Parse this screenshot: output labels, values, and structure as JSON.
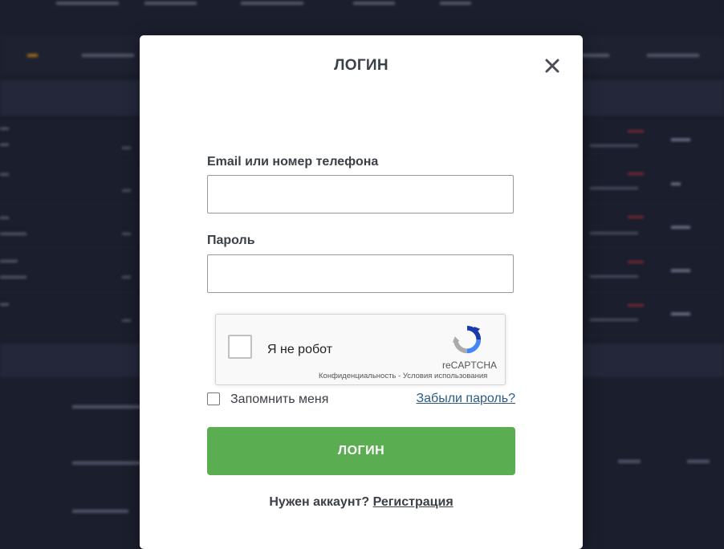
{
  "modal": {
    "title": "ЛОГИН",
    "email_label": "Email или номер телефона",
    "email_value": "",
    "password_label": "Пароль",
    "password_value": "",
    "captcha": {
      "label": "Я не робот",
      "brand": "reCAPTCHA",
      "privacy": "Конфиденциальность",
      "separator": " - ",
      "terms": "Условия использования"
    },
    "remember_label": "Запомнить меня",
    "forgot_link": "Забыли пароль?",
    "login_button": "ЛОГИН",
    "signup_prompt": "Нужен аккаунт?",
    "signup_link": "Регистрация"
  },
  "colors": {
    "page_background": "#1b1e2c",
    "login_button": "#5aad51",
    "link": "#2c5b87",
    "title_text": "#3b3f46"
  }
}
